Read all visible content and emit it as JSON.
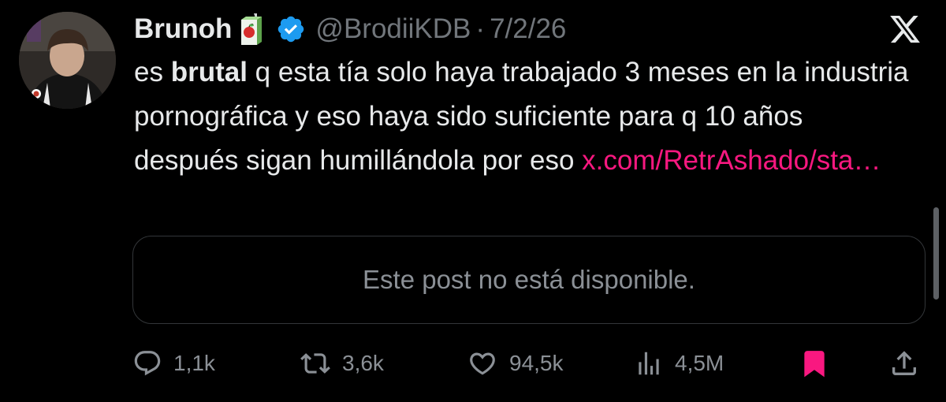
{
  "author": {
    "display_name": "Brunoh",
    "handle": "@BrodiiKDB",
    "separator": "·",
    "date": "7/2/26",
    "avatar_icon": "profile-photo",
    "badge_icon": "juice-box-icon",
    "verified_icon": "verified-badge-icon"
  },
  "platform_logo": "x-logo",
  "post": {
    "text_before": "es ",
    "text_bold": "brutal",
    "text_after": " q esta tía solo haya trabajado 3 meses en la industria pornográfica y eso haya sido suficiente para q 10 años después sigan humillándola por eso ",
    "link_text": "x.com/RetrAshado/sta…"
  },
  "quote": {
    "unavailable_text": "Este post no está disponible."
  },
  "actions": {
    "replies": "1,1k",
    "reposts": "3,6k",
    "likes": "94,5k",
    "views": "4,5M"
  },
  "colors": {
    "background": "#000000",
    "text": "#e7e9ea",
    "muted": "#71767b",
    "accent": "#f91880",
    "verified": "#1d9bf0"
  }
}
